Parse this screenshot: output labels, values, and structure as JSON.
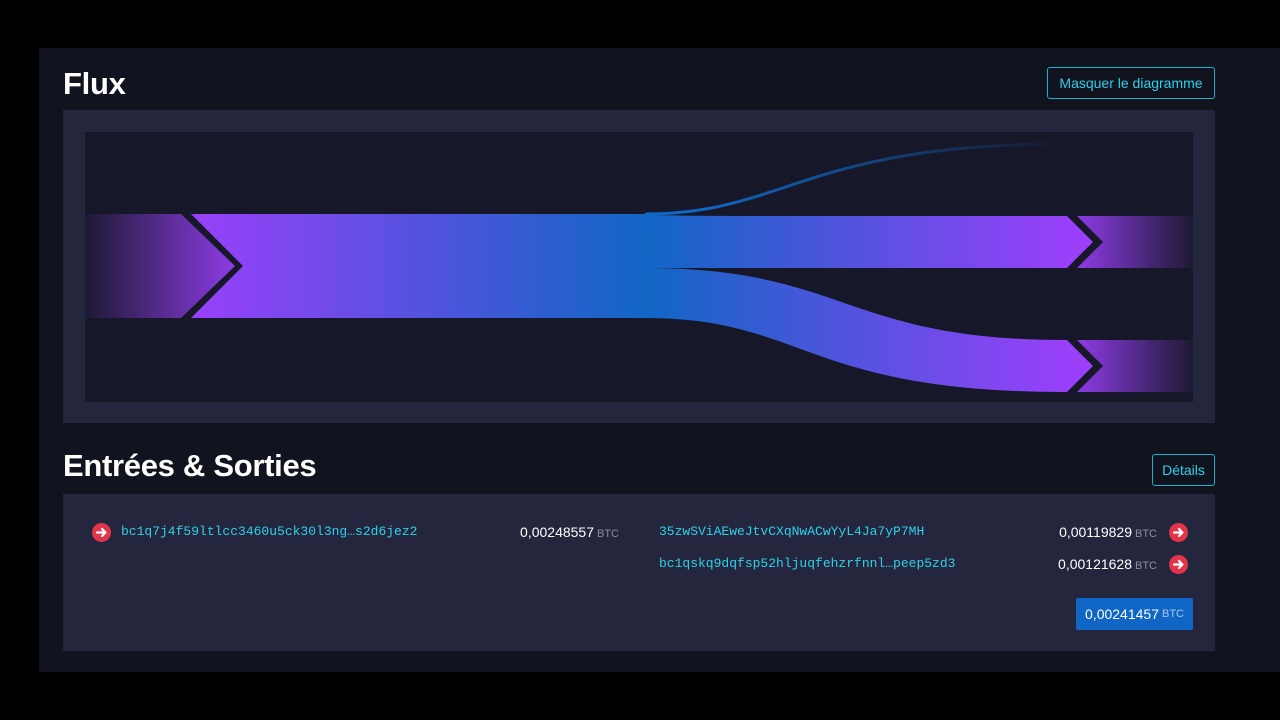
{
  "flux": {
    "title": "Flux",
    "hide_button": "Masquer le diagramme"
  },
  "io": {
    "title": "Entrées & Sorties",
    "details_button": "Détails",
    "inputs": [
      {
        "address": "bc1q7j4f59ltlcc3460u5ck30l3ng…s2d6jez2",
        "amount": "0,00248557",
        "unit": "BTC"
      }
    ],
    "outputs": [
      {
        "address": "35zwSViAEweJtvCXqNwACwYyL4Ja7yP7MH",
        "amount": "0,00119829",
        "unit": "BTC"
      },
      {
        "address": "bc1qskq9dqfsp52hljuqfehzrfnnl…peep5zd3",
        "amount": "0,00121628",
        "unit": "BTC"
      }
    ],
    "total": {
      "amount": "0,00241457",
      "unit": "BTC"
    }
  },
  "colors": {
    "accent": "#2fd0ea",
    "flow_purple": "#9b3ffa",
    "flow_blue": "#1066c4",
    "arrow_red": "#e2344a"
  }
}
